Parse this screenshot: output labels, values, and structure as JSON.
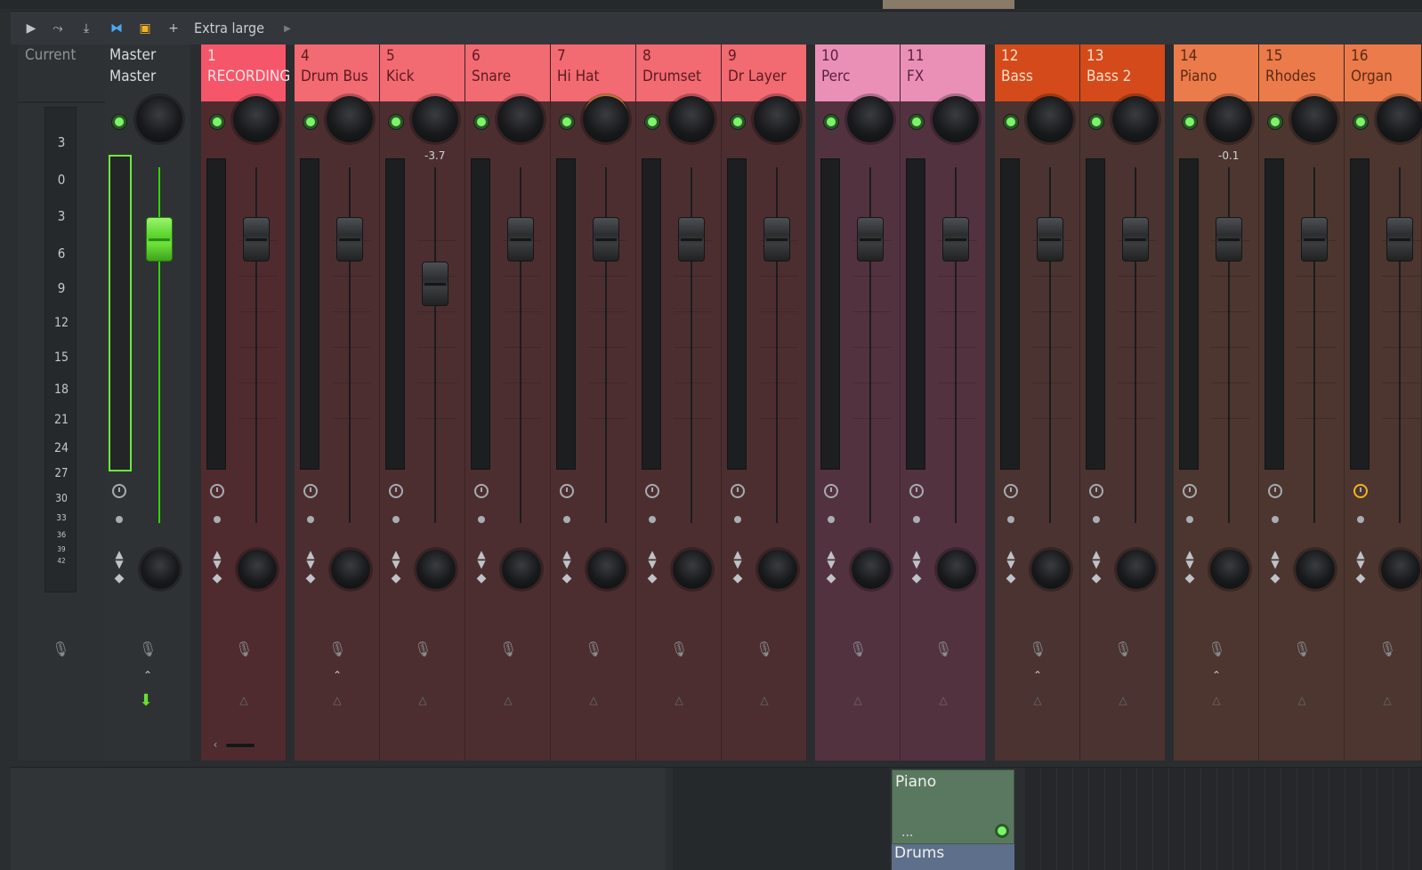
{
  "toolbar": {
    "view_label": "Extra large"
  },
  "current_column": {
    "label": "Current",
    "scale": [
      "3",
      "0",
      "3",
      "6",
      "9",
      "12",
      "15",
      "18",
      "21",
      "24",
      "27",
      "30",
      "33",
      "36",
      "39",
      "42"
    ]
  },
  "master": {
    "label_top": "Master",
    "label_bottom": "Master"
  },
  "tracks": [
    {
      "num": "1",
      "name": "RECORDING"
    },
    {
      "num": "4",
      "name": "Drum Bus"
    },
    {
      "num": "5",
      "name": "Kick",
      "value": "-3.7"
    },
    {
      "num": "6",
      "name": "Snare"
    },
    {
      "num": "7",
      "name": "Hi Hat"
    },
    {
      "num": "8",
      "name": "Drumset"
    },
    {
      "num": "9",
      "name": "Dr Layer"
    },
    {
      "num": "10",
      "name": "Perc"
    },
    {
      "num": "11",
      "name": "FX"
    },
    {
      "num": "12",
      "name": "Bass"
    },
    {
      "num": "13",
      "name": "Bass 2"
    },
    {
      "num": "14",
      "name": "Piano",
      "value": "-0.1"
    },
    {
      "num": "15",
      "name": "Rhodes"
    },
    {
      "num": "16",
      "name": "Organ"
    }
  ],
  "playlist": {
    "clip_piano": "Piano",
    "clip_piano_dots": "...",
    "clip_drums": "Drums"
  },
  "colors": {
    "recording": "#f5566a",
    "drums": "#f26a72",
    "perc": "#ea90b6",
    "bass": "#d44a1a",
    "keys": "#eb7b4a",
    "led": "#7cf46a",
    "master_fader": "#5fdc2e"
  }
}
